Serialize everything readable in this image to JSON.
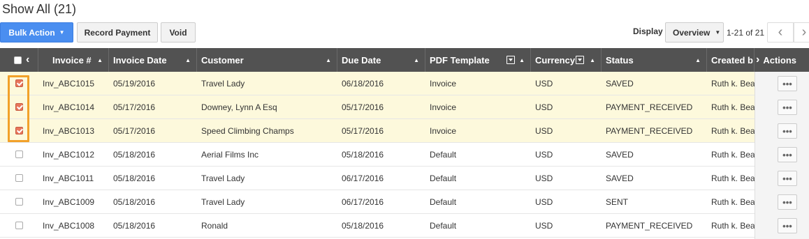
{
  "page": {
    "title": "Show All (21)"
  },
  "toolbar": {
    "bulk_action_label": "Bulk Action",
    "record_payment_label": "Record Payment",
    "void_label": "Void",
    "display_label": "Display",
    "display_value": "Overview",
    "pager_text": "1-21 of 21"
  },
  "columns": {
    "invoice": "Invoice #",
    "invoice_date": "Invoice Date",
    "customer": "Customer",
    "due_date": "Due Date",
    "pdf_template": "PDF Template",
    "currency": "Currency",
    "status": "Status",
    "created_by": "Created b",
    "actions": "Actions"
  },
  "rows": [
    {
      "invoice": "Inv_ABC1015",
      "invoice_date": "05/19/2016",
      "customer": "Travel Lady",
      "due_date": "06/18/2016",
      "pdf_template": "Invoice",
      "currency": "USD",
      "status": "SAVED",
      "created_by": "Ruth k. Bea",
      "selected": true
    },
    {
      "invoice": "Inv_ABC1014",
      "invoice_date": "05/17/2016",
      "customer": "Downey, Lynn A Esq",
      "due_date": "05/17/2016",
      "pdf_template": "Invoice",
      "currency": "USD",
      "status": "PAYMENT_RECEIVED",
      "created_by": "Ruth k. Bea",
      "selected": true
    },
    {
      "invoice": "Inv_ABC1013",
      "invoice_date": "05/17/2016",
      "customer": "Speed Climbing Champs",
      "due_date": "05/17/2016",
      "pdf_template": "Invoice",
      "currency": "USD",
      "status": "PAYMENT_RECEIVED",
      "created_by": "Ruth k. Bea",
      "selected": true
    },
    {
      "invoice": "Inv_ABC1012",
      "invoice_date": "05/18/2016",
      "customer": "Aerial Films Inc",
      "due_date": "05/18/2016",
      "pdf_template": "Default",
      "currency": "USD",
      "status": "SAVED",
      "created_by": "Ruth k. Bea",
      "selected": false
    },
    {
      "invoice": "Inv_ABC1011",
      "invoice_date": "05/18/2016",
      "customer": "Travel Lady",
      "due_date": "06/17/2016",
      "pdf_template": "Default",
      "currency": "USD",
      "status": "SAVED",
      "created_by": "Ruth k. Bea",
      "selected": false
    },
    {
      "invoice": "Inv_ABC1009",
      "invoice_date": "05/18/2016",
      "customer": "Travel Lady",
      "due_date": "06/17/2016",
      "pdf_template": "Default",
      "currency": "USD",
      "status": "SENT",
      "created_by": "Ruth k. Bea",
      "selected": false
    },
    {
      "invoice": "Inv_ABC1008",
      "invoice_date": "05/18/2016",
      "customer": "Ronald",
      "due_date": "05/18/2016",
      "pdf_template": "Default",
      "currency": "USD",
      "status": "PAYMENT_RECEIVED",
      "created_by": "Ruth k. Bea",
      "selected": false
    }
  ],
  "row_action_label": "•••",
  "colors": {
    "primary": "#4a8ef0",
    "header_bg": "#525252",
    "selected_row": "#fdf9dc",
    "highlight": "#f2a12a",
    "checked": "#e8765c"
  }
}
